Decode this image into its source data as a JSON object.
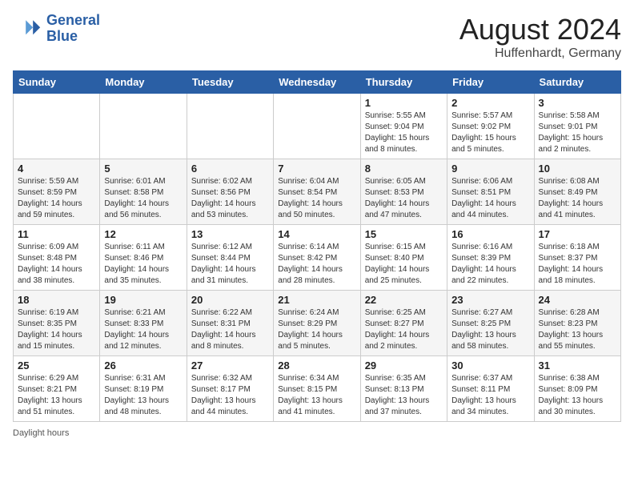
{
  "header": {
    "logo_line1": "General",
    "logo_line2": "Blue",
    "month_year": "August 2024",
    "location": "Huffenhardt, Germany"
  },
  "weekdays": [
    "Sunday",
    "Monday",
    "Tuesday",
    "Wednesday",
    "Thursday",
    "Friday",
    "Saturday"
  ],
  "weeks": [
    [
      {
        "day": "",
        "info": ""
      },
      {
        "day": "",
        "info": ""
      },
      {
        "day": "",
        "info": ""
      },
      {
        "day": "",
        "info": ""
      },
      {
        "day": "1",
        "info": "Sunrise: 5:55 AM\nSunset: 9:04 PM\nDaylight: 15 hours\nand 8 minutes."
      },
      {
        "day": "2",
        "info": "Sunrise: 5:57 AM\nSunset: 9:02 PM\nDaylight: 15 hours\nand 5 minutes."
      },
      {
        "day": "3",
        "info": "Sunrise: 5:58 AM\nSunset: 9:01 PM\nDaylight: 15 hours\nand 2 minutes."
      }
    ],
    [
      {
        "day": "4",
        "info": "Sunrise: 5:59 AM\nSunset: 8:59 PM\nDaylight: 14 hours\nand 59 minutes."
      },
      {
        "day": "5",
        "info": "Sunrise: 6:01 AM\nSunset: 8:58 PM\nDaylight: 14 hours\nand 56 minutes."
      },
      {
        "day": "6",
        "info": "Sunrise: 6:02 AM\nSunset: 8:56 PM\nDaylight: 14 hours\nand 53 minutes."
      },
      {
        "day": "7",
        "info": "Sunrise: 6:04 AM\nSunset: 8:54 PM\nDaylight: 14 hours\nand 50 minutes."
      },
      {
        "day": "8",
        "info": "Sunrise: 6:05 AM\nSunset: 8:53 PM\nDaylight: 14 hours\nand 47 minutes."
      },
      {
        "day": "9",
        "info": "Sunrise: 6:06 AM\nSunset: 8:51 PM\nDaylight: 14 hours\nand 44 minutes."
      },
      {
        "day": "10",
        "info": "Sunrise: 6:08 AM\nSunset: 8:49 PM\nDaylight: 14 hours\nand 41 minutes."
      }
    ],
    [
      {
        "day": "11",
        "info": "Sunrise: 6:09 AM\nSunset: 8:48 PM\nDaylight: 14 hours\nand 38 minutes."
      },
      {
        "day": "12",
        "info": "Sunrise: 6:11 AM\nSunset: 8:46 PM\nDaylight: 14 hours\nand 35 minutes."
      },
      {
        "day": "13",
        "info": "Sunrise: 6:12 AM\nSunset: 8:44 PM\nDaylight: 14 hours\nand 31 minutes."
      },
      {
        "day": "14",
        "info": "Sunrise: 6:14 AM\nSunset: 8:42 PM\nDaylight: 14 hours\nand 28 minutes."
      },
      {
        "day": "15",
        "info": "Sunrise: 6:15 AM\nSunset: 8:40 PM\nDaylight: 14 hours\nand 25 minutes."
      },
      {
        "day": "16",
        "info": "Sunrise: 6:16 AM\nSunset: 8:39 PM\nDaylight: 14 hours\nand 22 minutes."
      },
      {
        "day": "17",
        "info": "Sunrise: 6:18 AM\nSunset: 8:37 PM\nDaylight: 14 hours\nand 18 minutes."
      }
    ],
    [
      {
        "day": "18",
        "info": "Sunrise: 6:19 AM\nSunset: 8:35 PM\nDaylight: 14 hours\nand 15 minutes."
      },
      {
        "day": "19",
        "info": "Sunrise: 6:21 AM\nSunset: 8:33 PM\nDaylight: 14 hours\nand 12 minutes."
      },
      {
        "day": "20",
        "info": "Sunrise: 6:22 AM\nSunset: 8:31 PM\nDaylight: 14 hours\nand 8 minutes."
      },
      {
        "day": "21",
        "info": "Sunrise: 6:24 AM\nSunset: 8:29 PM\nDaylight: 14 hours\nand 5 minutes."
      },
      {
        "day": "22",
        "info": "Sunrise: 6:25 AM\nSunset: 8:27 PM\nDaylight: 14 hours\nand 2 minutes."
      },
      {
        "day": "23",
        "info": "Sunrise: 6:27 AM\nSunset: 8:25 PM\nDaylight: 13 hours\nand 58 minutes."
      },
      {
        "day": "24",
        "info": "Sunrise: 6:28 AM\nSunset: 8:23 PM\nDaylight: 13 hours\nand 55 minutes."
      }
    ],
    [
      {
        "day": "25",
        "info": "Sunrise: 6:29 AM\nSunset: 8:21 PM\nDaylight: 13 hours\nand 51 minutes."
      },
      {
        "day": "26",
        "info": "Sunrise: 6:31 AM\nSunset: 8:19 PM\nDaylight: 13 hours\nand 48 minutes."
      },
      {
        "day": "27",
        "info": "Sunrise: 6:32 AM\nSunset: 8:17 PM\nDaylight: 13 hours\nand 44 minutes."
      },
      {
        "day": "28",
        "info": "Sunrise: 6:34 AM\nSunset: 8:15 PM\nDaylight: 13 hours\nand 41 minutes."
      },
      {
        "day": "29",
        "info": "Sunrise: 6:35 AM\nSunset: 8:13 PM\nDaylight: 13 hours\nand 37 minutes."
      },
      {
        "day": "30",
        "info": "Sunrise: 6:37 AM\nSunset: 8:11 PM\nDaylight: 13 hours\nand 34 minutes."
      },
      {
        "day": "31",
        "info": "Sunrise: 6:38 AM\nSunset: 8:09 PM\nDaylight: 13 hours\nand 30 minutes."
      }
    ]
  ],
  "footer": {
    "daylight_label": "Daylight hours"
  }
}
